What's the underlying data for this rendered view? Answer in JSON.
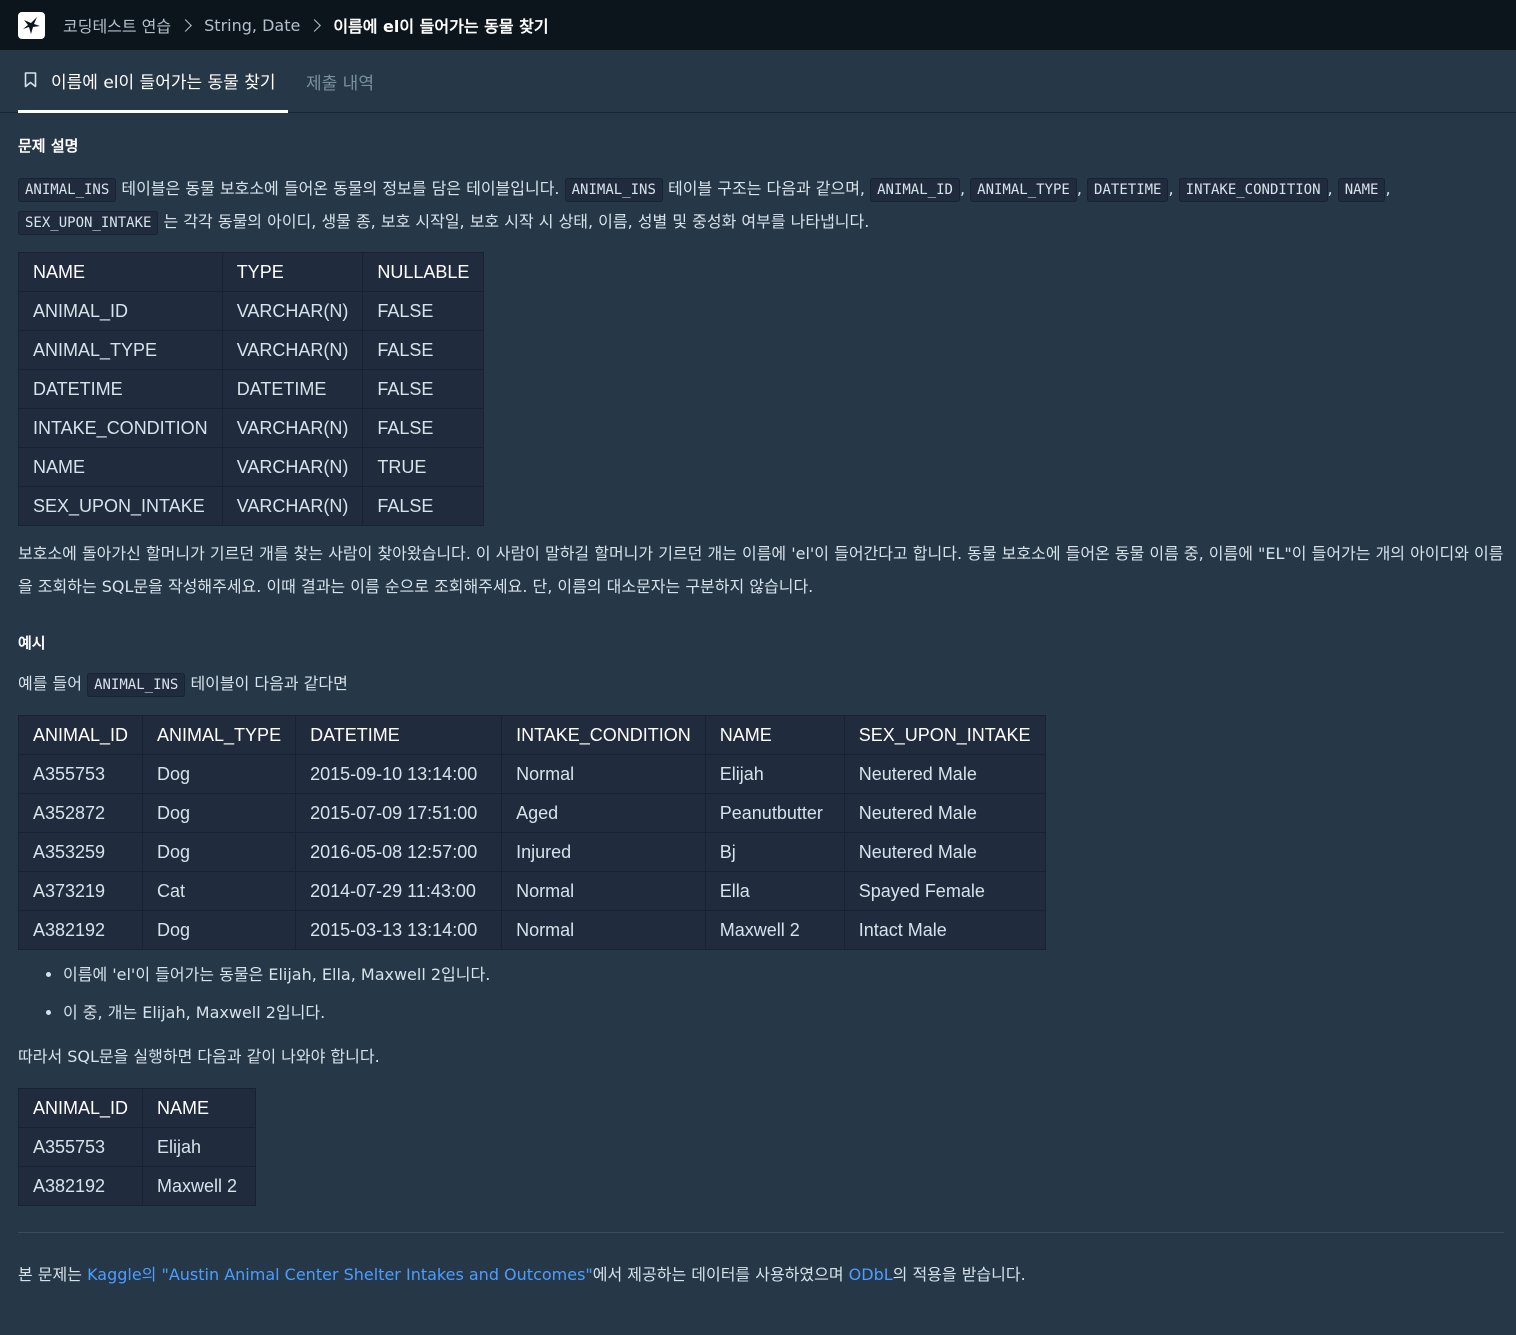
{
  "topbar": {
    "breadcrumbs": [
      "코딩테스트 연습",
      "String, Date"
    ],
    "current": "이름에 el이 들어가는 동물 찾기"
  },
  "tabs": {
    "active": "이름에 el이 들어가는 동물 찾기",
    "inactive": "제출 내역"
  },
  "problem": {
    "heading": "문제 설명",
    "intro": {
      "code_table": "ANIMAL_INS",
      "text1": "테이블은 동물 보호소에 들어온 동물의 정보를 담은 테이블입니다.",
      "text2": "테이블 구조는 다음과 같으며,",
      "cols": [
        "ANIMAL_ID",
        "ANIMAL_TYPE",
        "DATETIME",
        "INTAKE_CONDITION",
        "NAME",
        "SEX_UPON_INTAKE"
      ],
      "sep": ",",
      "text3": "는 각각 동물의 아이디, 생물 종, 보호 시작일, 보호 시작 시 상태, 이름, 성별 및 중성화 여부를 나타냅니다."
    },
    "schema_table": {
      "headers": [
        "NAME",
        "TYPE",
        "NULLABLE"
      ],
      "rows": [
        [
          "ANIMAL_ID",
          "VARCHAR(N)",
          "FALSE"
        ],
        [
          "ANIMAL_TYPE",
          "VARCHAR(N)",
          "FALSE"
        ],
        [
          "DATETIME",
          "DATETIME",
          "FALSE"
        ],
        [
          "INTAKE_CONDITION",
          "VARCHAR(N)",
          "FALSE"
        ],
        [
          "NAME",
          "VARCHAR(N)",
          "TRUE"
        ],
        [
          "SEX_UPON_INTAKE",
          "VARCHAR(N)",
          "FALSE"
        ]
      ]
    },
    "description": "보호소에 돌아가신 할머니가 기르던 개를 찾는 사람이 찾아왔습니다. 이 사람이 말하길 할머니가 기르던 개는 이름에 'el'이 들어간다고 합니다. 동물 보호소에 들어온 동물 이름 중, 이름에 \"EL\"이 들어가는 개의 아이디와 이름을 조회하는 SQL문을 작성해주세요. 이때 결과는 이름 순으로 조회해주세요. 단, 이름의 대소문자는 구분하지 않습니다."
  },
  "example": {
    "heading": "예시",
    "lead_before": "예를 들어",
    "lead_code": "ANIMAL_INS",
    "lead_after": "테이블이 다음과 같다면",
    "table": {
      "headers": [
        "ANIMAL_ID",
        "ANIMAL_TYPE",
        "DATETIME",
        "INTAKE_CONDITION",
        "NAME",
        "SEX_UPON_INTAKE"
      ],
      "rows": [
        [
          "A355753",
          "Dog",
          "2015-09-10 13:14:00",
          "Normal",
          "Elijah",
          "Neutered Male"
        ],
        [
          "A352872",
          "Dog",
          "2015-07-09 17:51:00",
          "Aged",
          "Peanutbutter",
          "Neutered Male"
        ],
        [
          "A353259",
          "Dog",
          "2016-05-08 12:57:00",
          "Injured",
          "Bj",
          "Neutered Male"
        ],
        [
          "A373219",
          "Cat",
          "2014-07-29 11:43:00",
          "Normal",
          "Ella",
          "Spayed Female"
        ],
        [
          "A382192",
          "Dog",
          "2015-03-13 13:14:00",
          "Normal",
          "Maxwell 2",
          "Intact Male"
        ]
      ]
    },
    "bullets": [
      "이름에 'el'이 들어가는 동물은 Elijah, Ella, Maxwell 2입니다.",
      "이 중, 개는 Elijah, Maxwell 2입니다."
    ],
    "result_lead": "따라서 SQL문을 실행하면 다음과 같이 나와야 합니다.",
    "result_table": {
      "headers": [
        "ANIMAL_ID",
        "NAME"
      ],
      "rows": [
        [
          "A355753",
          "Elijah"
        ],
        [
          "A382192",
          "Maxwell 2"
        ]
      ]
    }
  },
  "footer": {
    "before": "본 문제는",
    "link1": "Kaggle의 \"Austin Animal Center Shelter Intakes and Outcomes\"",
    "middle": "에서 제공하는 데이터를 사용하였으며",
    "link2": "ODbL",
    "after": "의 적용을 받습니다."
  }
}
